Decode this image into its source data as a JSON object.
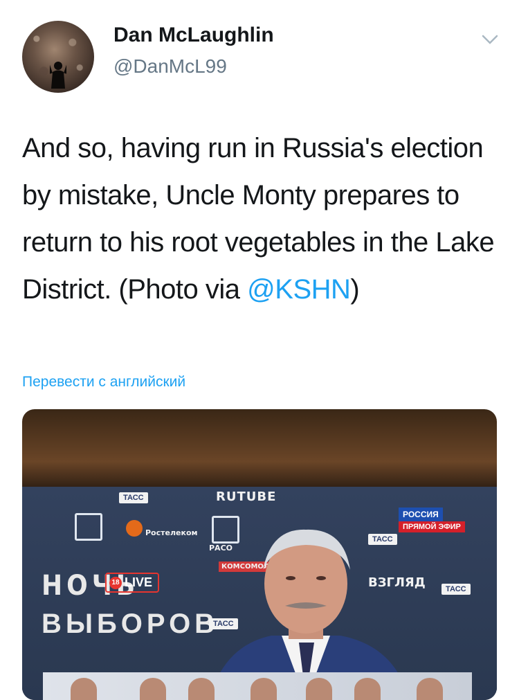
{
  "author": {
    "display_name": "Dan McLaughlin",
    "handle": "@DanMcL99"
  },
  "tweet": {
    "text_before": "And so, having run in Russia's election by mistake, Uncle Monty prepares to return to his root vegetables in the Lake District. (Photo via ",
    "mention": "@KSHN",
    "text_after": ")"
  },
  "translate_link": "Перевести с английский",
  "media": {
    "tv_texts": {
      "noch": "НОЧЬ",
      "vyborov": "ВЫБОРОВ",
      "live": "LIVE",
      "live_num": "18",
      "rutube": "RUTUBE",
      "rostelecom": "Ростелеком",
      "raso": "РАСО",
      "tass": "ТАСС",
      "vzglyad": "ВЗГЛЯД",
      "rossiya": "РОССИЯ",
      "efir": "ПРЯМОЙ ЭФИР",
      "kp": "КОМСОМОЛЬСКАЯ ПРАВДА"
    }
  },
  "colors": {
    "link": "#1da1f2",
    "text": "#14171a",
    "secondary": "#657786"
  },
  "icons": {
    "caret": "chevron-down-icon"
  }
}
